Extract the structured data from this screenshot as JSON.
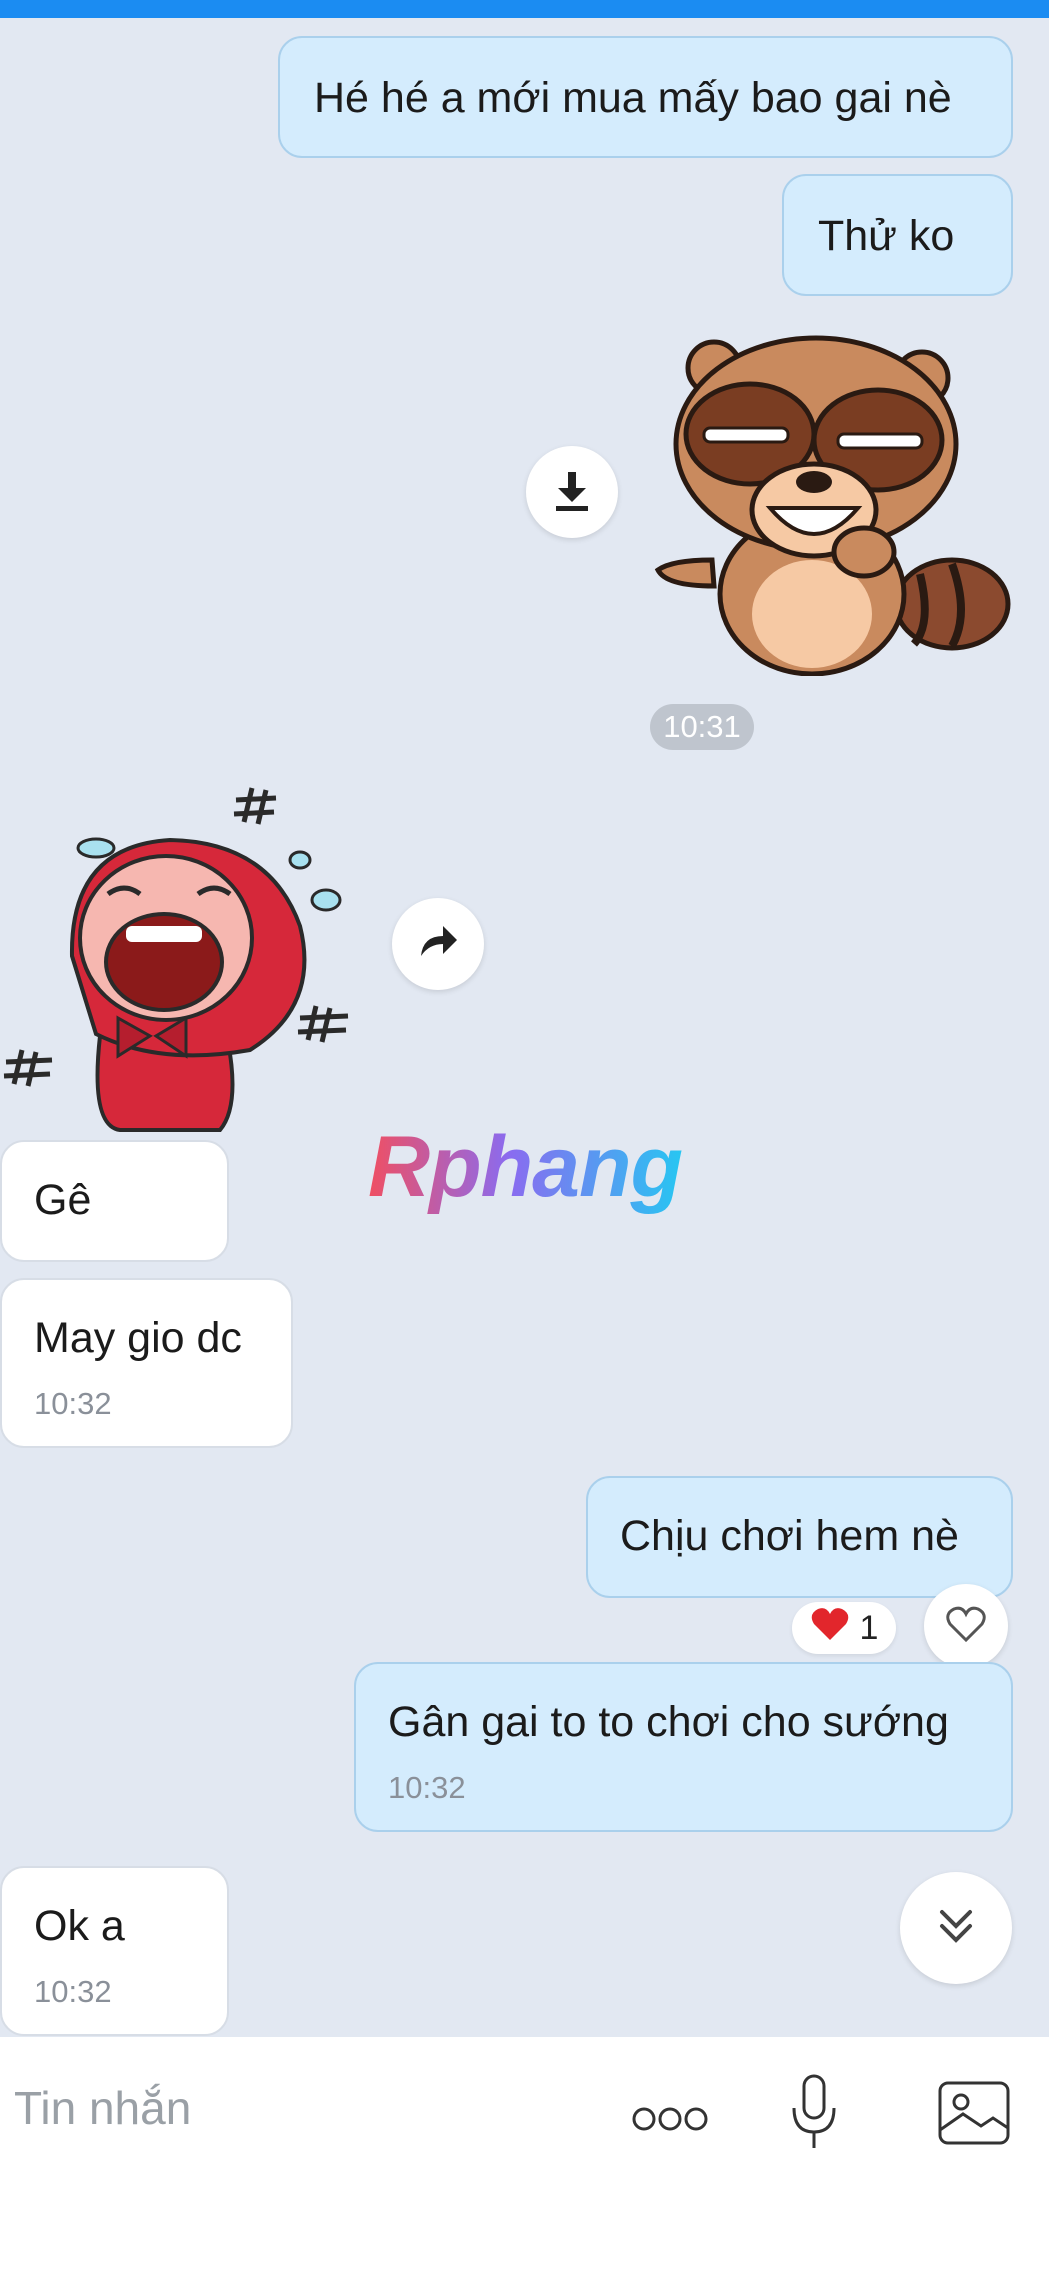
{
  "messages": [
    {
      "direction": "out",
      "text": "Hé hé a mới mua mấy bao gai nè"
    },
    {
      "direction": "out",
      "text": "Thử ko"
    },
    {
      "direction": "out",
      "type": "sticker",
      "sticker": "raccoon-grin"
    },
    {
      "direction": "in",
      "type": "sticker",
      "sticker": "red-hood-laughing"
    },
    {
      "direction": "in",
      "text": "Gê"
    },
    {
      "direction": "in",
      "text": "May gio dc",
      "time": "10:32"
    },
    {
      "direction": "out",
      "text": "Chịu chơi hem nè",
      "reaction": {
        "emoji": "❤",
        "count": "1"
      }
    },
    {
      "direction": "out",
      "text": "Gân gai to to chơi cho sướng",
      "time": "10:32"
    },
    {
      "direction": "in",
      "text": "Ok a",
      "time": "10:32"
    }
  ],
  "time_separator": "10:31",
  "watermark": "Rphang",
  "composer": {
    "placeholder": "Tin nhắn",
    "icons": [
      "more-icon",
      "microphone-icon",
      "image-icon"
    ]
  },
  "colors": {
    "accent": "#1b8cf2",
    "background": "#e2e8f2",
    "outgoing_bubble": "#d4ecfd",
    "incoming_bubble": "#ffffff",
    "heart": "#e2262c"
  }
}
